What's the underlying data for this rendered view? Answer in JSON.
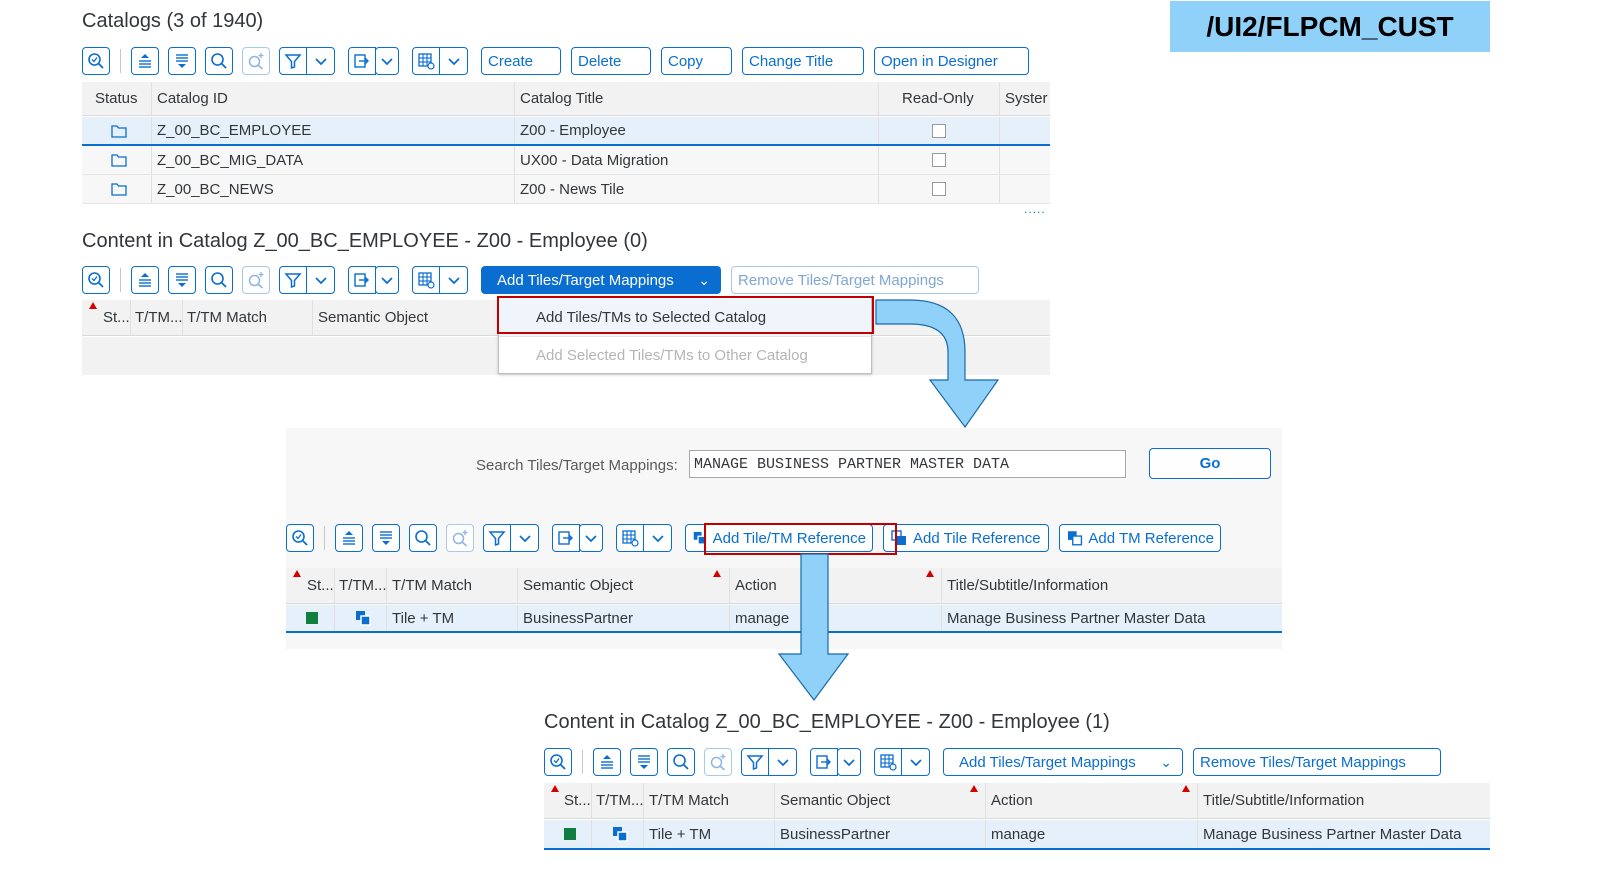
{
  "badge": "/UI2/FLPCM_CUST",
  "catalogs": {
    "title": "Catalogs (3 of 1940)",
    "buttons": [
      "Create",
      "Delete",
      "Copy",
      "Change Title",
      "Open in Designer"
    ],
    "columns": [
      "Status",
      "Catalog ID",
      "Catalog Title",
      "Read-Only",
      "Syster"
    ],
    "rows": [
      {
        "id": "Z_00_BC_EMPLOYEE",
        "title": "Z00 - Employee"
      },
      {
        "id": "Z_00_BC_MIG_DATA",
        "title": "UX00 - Data Migration"
      },
      {
        "id": "Z_00_BC_NEWS",
        "title": "Z00 - News Tile"
      }
    ],
    "more": "....."
  },
  "content1": {
    "title": "Content in Catalog Z_00_BC_EMPLOYEE - Z00 - Employee (0)",
    "add_btn": "Add Tiles/Target Mappings",
    "remove_btn": "Remove Tiles/Target Mappings",
    "columns": [
      "St...",
      "T/TM...",
      "T/TM Match",
      "Semantic Object"
    ],
    "menu": [
      "Add Tiles/TMs to Selected Catalog",
      "Add Selected Tiles/TMs to Other Catalog"
    ]
  },
  "search": {
    "label": "Search Tiles/Target Mappings:",
    "value": "MANAGE BUSINESS PARTNER MASTER DATA",
    "go": "Go",
    "buttons": [
      "Add Tile/TM Reference",
      "Add Tile Reference",
      "Add TM Reference"
    ],
    "columns": [
      "St...",
      "T/TM...",
      "T/TM Match",
      "Semantic Object",
      "Action",
      "Title/Subtitle/Information"
    ],
    "row": {
      "match": "Tile + TM",
      "object": "BusinessPartner",
      "action": "manage",
      "title": "Manage Business Partner Master Data"
    }
  },
  "content2": {
    "title": "Content in Catalog Z_00_BC_EMPLOYEE - Z00 - Employee (1)",
    "add_btn": "Add Tiles/Target Mappings",
    "remove_btn": "Remove Tiles/Target Mappings",
    "columns": [
      "St...",
      "T/TM...",
      "T/TM Match",
      "Semantic Object",
      "Action",
      "Title/Subtitle/Information"
    ],
    "row": {
      "match": "Tile + TM",
      "object": "BusinessPartner",
      "action": "manage",
      "title": "Manage Business Partner Master Data"
    }
  },
  "colors": {
    "accent": "#0a6ed1",
    "highlight": "#c00000",
    "arrow": "#8fd1f9",
    "status_ok": "#107e3e"
  }
}
